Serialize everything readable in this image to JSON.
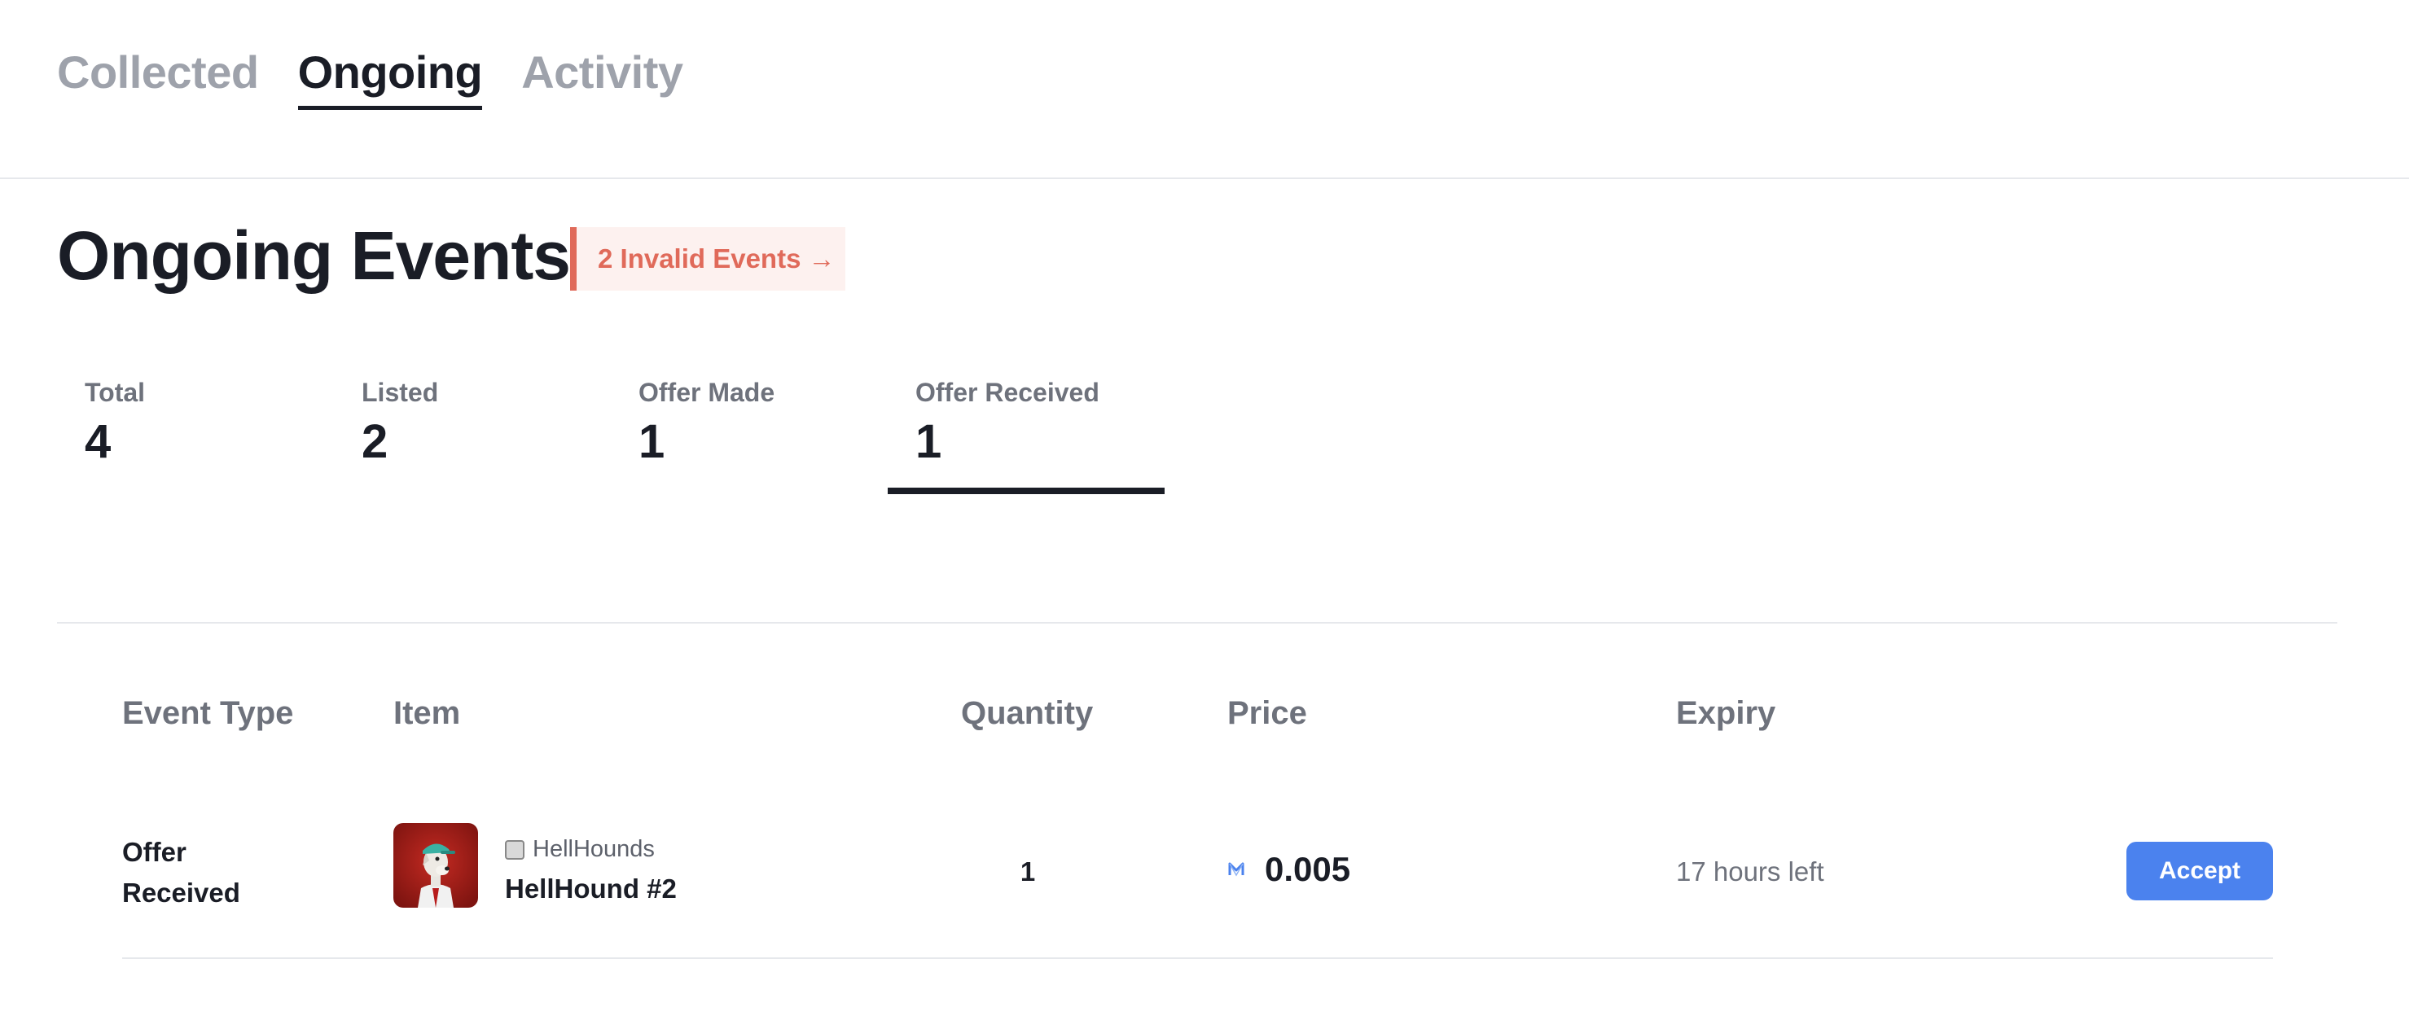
{
  "tabs": {
    "collected": "Collected",
    "ongoing": "Ongoing",
    "activity": "Activity",
    "active": "ongoing"
  },
  "heading": {
    "title": "Ongoing Events",
    "invalid_badge": "2 Invalid Events →"
  },
  "stats": [
    {
      "label": "Total",
      "value": "4"
    },
    {
      "label": "Listed",
      "value": "2"
    },
    {
      "label": "Offer Made",
      "value": "1"
    },
    {
      "label": "Offer Received",
      "value": "1"
    }
  ],
  "active_stat": "Offer Received",
  "table": {
    "headers": {
      "event_type": "Event Type",
      "item": "Item",
      "quantity": "Quantity",
      "price": "Price",
      "expiry": "Expiry"
    },
    "rows": [
      {
        "event_type_line1": "Offer",
        "event_type_line2": "Received",
        "collection": "HellHounds",
        "item_name": "HellHound #2",
        "quantity": "1",
        "price": "0.005",
        "currency_icon": "token-icon",
        "expiry": "17 hours left",
        "action": "Accept"
      }
    ]
  },
  "colors": {
    "accent": "#4b82ee",
    "danger": "#e06a5a",
    "danger_bg": "#fdf1ef",
    "text": "#1a1d26",
    "muted": "#6e727c"
  }
}
